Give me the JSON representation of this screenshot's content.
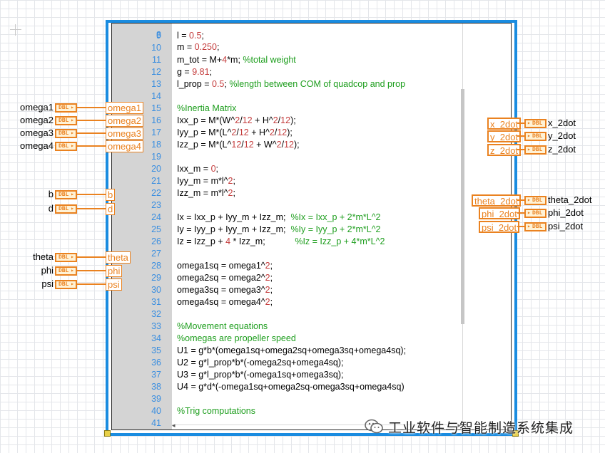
{
  "colors": {
    "node_border": "#1a8ce0",
    "gutter": "#d4d4d4",
    "line_number": "#3a8ee0",
    "comment": "#1e9e1e",
    "number": "#c43c3c",
    "terminal_orange": "#ea8220"
  },
  "terminal_type_label": "DBL",
  "code": {
    "partial_top_line": "m = 0.250;",
    "lines": [
      {
        "n": "9",
        "text": "l = 0.5;"
      },
      {
        "n": "10",
        "text": ""
      },
      {
        "n": "11",
        "text": "m_tot = M+4*m; %total weight"
      },
      {
        "n": "12",
        "text": "g = 9.81;"
      },
      {
        "n": "13",
        "text": "l_prop = 0.5; %length between COM of quadcop and prop"
      },
      {
        "n": "14",
        "text": ""
      },
      {
        "n": "15",
        "text": "%Inertia Matrix"
      },
      {
        "n": "16",
        "text": "Ixx_p = M*(W^2/12 + H^2/12);"
      },
      {
        "n": "17",
        "text": "Iyy_p = M*(L^2/12 + H^2/12);"
      },
      {
        "n": "18",
        "text": "Izz_p = M*(L^12/12 + W^2/12);"
      },
      {
        "n": "19",
        "text": ""
      },
      {
        "n": "20",
        "text": "Ixx_m = 0;"
      },
      {
        "n": "21",
        "text": "Iyy_m = m*l^2;"
      },
      {
        "n": "22",
        "text": "Izz_m = m*l^2;"
      },
      {
        "n": "23",
        "text": ""
      },
      {
        "n": "24",
        "text": "Ix = Ixx_p + Iyy_m + Izz_m;  %Ix = Ixx_p + 2*m*L^2"
      },
      {
        "n": "25",
        "text": "Iy = Iyy_p + Iyy_m + Izz_m;  %Iy = Iyy_p + 2*m*L^2"
      },
      {
        "n": "26",
        "text": "Iz = Izz_p + 4 * Izz_m;            %Iz = Izz_p + 4*m*L^2"
      },
      {
        "n": "27",
        "text": ""
      },
      {
        "n": "28",
        "text": "omega1sq = omega1^2;"
      },
      {
        "n": "29",
        "text": "omega2sq = omega2^2;"
      },
      {
        "n": "30",
        "text": "omega3sq = omega3^2;"
      },
      {
        "n": "31",
        "text": "omega4sq = omega4^2;"
      },
      {
        "n": "32",
        "text": ""
      },
      {
        "n": "33",
        "text": "%Movement equations"
      },
      {
        "n": "34",
        "text": "%omegas are propeller speed"
      },
      {
        "n": "35",
        "text": "U1 = g*b*(omega1sq+omega2sq+omega3sq+omega4sq);"
      },
      {
        "n": "36",
        "text": "U2 = g*l_prop*b*(-omega2sq+omega4sq);"
      },
      {
        "n": "37",
        "text": "U3 = g*l_prop*b*(-omega1sq+omega3sq);"
      },
      {
        "n": "38",
        "text": "U4 = g*d*(-omega1sq+omega2sq-omega3sq+omega4sq)"
      },
      {
        "n": "39",
        "text": ""
      },
      {
        "n": "40",
        "text": "%Trig computations"
      },
      {
        "n": "41",
        "text": ""
      }
    ]
  },
  "inputs": [
    {
      "wire_label": "omega1",
      "node_var": "omega1"
    },
    {
      "wire_label": "omega2",
      "node_var": "omega2"
    },
    {
      "wire_label": "omega3",
      "node_var": "omega3"
    },
    {
      "wire_label": "omega4",
      "node_var": "omega4"
    },
    {
      "wire_label": "b",
      "node_var": "b"
    },
    {
      "wire_label": "d",
      "node_var": "d"
    },
    {
      "wire_label": "theta",
      "node_var": "theta"
    },
    {
      "wire_label": "phi",
      "node_var": "phi"
    },
    {
      "wire_label": "psi",
      "node_var": "psi"
    }
  ],
  "outputs": [
    {
      "node_var": "x_2dot",
      "wire_label": "x_2dot"
    },
    {
      "node_var": "y_2dot",
      "wire_label": "y_2dot"
    },
    {
      "node_var": "z_2dot",
      "wire_label": "z_2dot"
    },
    {
      "node_var": "theta_2dot",
      "wire_label": "theta_2dot"
    },
    {
      "node_var": "phi_2dot",
      "wire_label": "phi_2dot"
    },
    {
      "node_var": "psi_2dot",
      "wire_label": "psi_2dot"
    }
  ],
  "watermark": {
    "text": "工业软件与智能制造系统集成",
    "icon": "wechat-icon"
  }
}
